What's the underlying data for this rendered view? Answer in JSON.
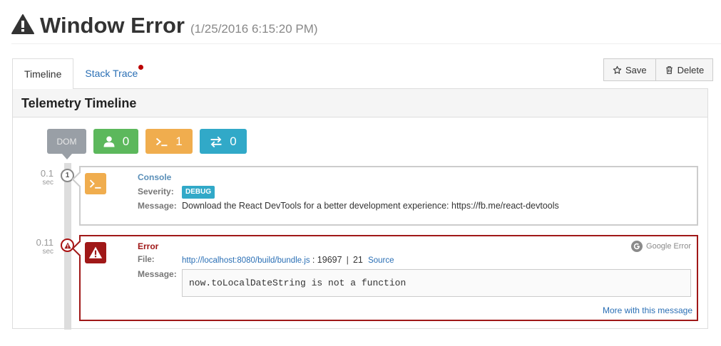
{
  "page": {
    "title": "Window Error",
    "date": "(1/25/2016 6:15:20 PM)",
    "title_icon": "warning-icon"
  },
  "tabs": [
    {
      "label": "Timeline",
      "active": true
    },
    {
      "label": "Stack Trace",
      "active": false,
      "has_notification": true
    }
  ],
  "actions": {
    "save_label": "Save",
    "save_icon": "star-outline-icon",
    "delete_label": "Delete",
    "delete_icon": "trash-icon"
  },
  "panel": {
    "title": "Telemetry Timeline"
  },
  "filters": {
    "dom": {
      "label": "DOM"
    },
    "user": {
      "count": "0",
      "icon": "user-icon",
      "color": "#5cb85c"
    },
    "console": {
      "count": "1",
      "icon": "terminal-icon",
      "color": "#f0ad4e"
    },
    "network": {
      "count": "0",
      "icon": "exchange-icon",
      "color": "#31a9c8"
    }
  },
  "entries": {
    "console": {
      "time": "0.1",
      "time_unit": "sec",
      "marker": "1",
      "title": "Console",
      "severity_label": "Severity:",
      "severity": "DEBUG",
      "message_label": "Message:",
      "message": "Download the React DevTools for a better development experience: https://fb.me/react-devtools"
    },
    "error": {
      "time": "0.11",
      "time_unit": "sec",
      "title": "Error",
      "file_label": "File:",
      "file_url": "http://localhost:8080/build/bundle.js",
      "file_line": ": 19697",
      "file_sep": "|",
      "file_col": "21",
      "source_label": "Source",
      "message_label": "Message:",
      "message": "now.toLocalDateString is not a function",
      "google_label": "Google Error",
      "more_label": "More with this message"
    }
  },
  "colors": {
    "error": "#a01818",
    "link": "#2a6fb5",
    "debug_badge": "#31a9c8"
  }
}
